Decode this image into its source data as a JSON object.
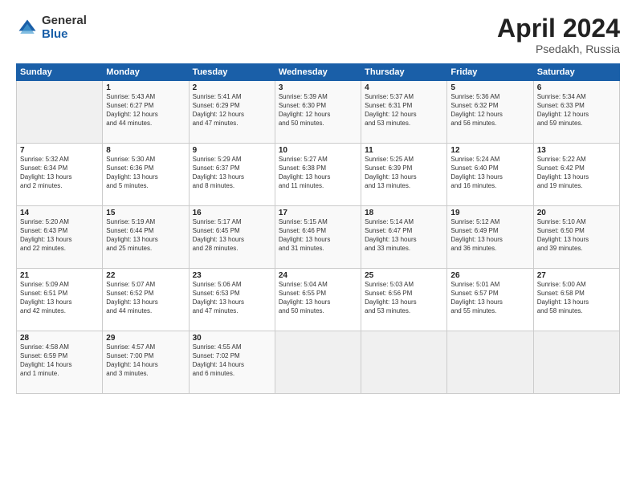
{
  "header": {
    "logo_general": "General",
    "logo_blue": "Blue",
    "title": "April 2024",
    "subtitle": "Psedakh, Russia"
  },
  "days_of_week": [
    "Sunday",
    "Monday",
    "Tuesday",
    "Wednesday",
    "Thursday",
    "Friday",
    "Saturday"
  ],
  "weeks": [
    [
      {
        "day": "",
        "info": ""
      },
      {
        "day": "1",
        "info": "Sunrise: 5:43 AM\nSunset: 6:27 PM\nDaylight: 12 hours\nand 44 minutes."
      },
      {
        "day": "2",
        "info": "Sunrise: 5:41 AM\nSunset: 6:29 PM\nDaylight: 12 hours\nand 47 minutes."
      },
      {
        "day": "3",
        "info": "Sunrise: 5:39 AM\nSunset: 6:30 PM\nDaylight: 12 hours\nand 50 minutes."
      },
      {
        "day": "4",
        "info": "Sunrise: 5:37 AM\nSunset: 6:31 PM\nDaylight: 12 hours\nand 53 minutes."
      },
      {
        "day": "5",
        "info": "Sunrise: 5:36 AM\nSunset: 6:32 PM\nDaylight: 12 hours\nand 56 minutes."
      },
      {
        "day": "6",
        "info": "Sunrise: 5:34 AM\nSunset: 6:33 PM\nDaylight: 12 hours\nand 59 minutes."
      }
    ],
    [
      {
        "day": "7",
        "info": "Sunrise: 5:32 AM\nSunset: 6:34 PM\nDaylight: 13 hours\nand 2 minutes."
      },
      {
        "day": "8",
        "info": "Sunrise: 5:30 AM\nSunset: 6:36 PM\nDaylight: 13 hours\nand 5 minutes."
      },
      {
        "day": "9",
        "info": "Sunrise: 5:29 AM\nSunset: 6:37 PM\nDaylight: 13 hours\nand 8 minutes."
      },
      {
        "day": "10",
        "info": "Sunrise: 5:27 AM\nSunset: 6:38 PM\nDaylight: 13 hours\nand 11 minutes."
      },
      {
        "day": "11",
        "info": "Sunrise: 5:25 AM\nSunset: 6:39 PM\nDaylight: 13 hours\nand 13 minutes."
      },
      {
        "day": "12",
        "info": "Sunrise: 5:24 AM\nSunset: 6:40 PM\nDaylight: 13 hours\nand 16 minutes."
      },
      {
        "day": "13",
        "info": "Sunrise: 5:22 AM\nSunset: 6:42 PM\nDaylight: 13 hours\nand 19 minutes."
      }
    ],
    [
      {
        "day": "14",
        "info": "Sunrise: 5:20 AM\nSunset: 6:43 PM\nDaylight: 13 hours\nand 22 minutes."
      },
      {
        "day": "15",
        "info": "Sunrise: 5:19 AM\nSunset: 6:44 PM\nDaylight: 13 hours\nand 25 minutes."
      },
      {
        "day": "16",
        "info": "Sunrise: 5:17 AM\nSunset: 6:45 PM\nDaylight: 13 hours\nand 28 minutes."
      },
      {
        "day": "17",
        "info": "Sunrise: 5:15 AM\nSunset: 6:46 PM\nDaylight: 13 hours\nand 31 minutes."
      },
      {
        "day": "18",
        "info": "Sunrise: 5:14 AM\nSunset: 6:47 PM\nDaylight: 13 hours\nand 33 minutes."
      },
      {
        "day": "19",
        "info": "Sunrise: 5:12 AM\nSunset: 6:49 PM\nDaylight: 13 hours\nand 36 minutes."
      },
      {
        "day": "20",
        "info": "Sunrise: 5:10 AM\nSunset: 6:50 PM\nDaylight: 13 hours\nand 39 minutes."
      }
    ],
    [
      {
        "day": "21",
        "info": "Sunrise: 5:09 AM\nSunset: 6:51 PM\nDaylight: 13 hours\nand 42 minutes."
      },
      {
        "day": "22",
        "info": "Sunrise: 5:07 AM\nSunset: 6:52 PM\nDaylight: 13 hours\nand 44 minutes."
      },
      {
        "day": "23",
        "info": "Sunrise: 5:06 AM\nSunset: 6:53 PM\nDaylight: 13 hours\nand 47 minutes."
      },
      {
        "day": "24",
        "info": "Sunrise: 5:04 AM\nSunset: 6:55 PM\nDaylight: 13 hours\nand 50 minutes."
      },
      {
        "day": "25",
        "info": "Sunrise: 5:03 AM\nSunset: 6:56 PM\nDaylight: 13 hours\nand 53 minutes."
      },
      {
        "day": "26",
        "info": "Sunrise: 5:01 AM\nSunset: 6:57 PM\nDaylight: 13 hours\nand 55 minutes."
      },
      {
        "day": "27",
        "info": "Sunrise: 5:00 AM\nSunset: 6:58 PM\nDaylight: 13 hours\nand 58 minutes."
      }
    ],
    [
      {
        "day": "28",
        "info": "Sunrise: 4:58 AM\nSunset: 6:59 PM\nDaylight: 14 hours\nand 1 minute."
      },
      {
        "day": "29",
        "info": "Sunrise: 4:57 AM\nSunset: 7:00 PM\nDaylight: 14 hours\nand 3 minutes."
      },
      {
        "day": "30",
        "info": "Sunrise: 4:55 AM\nSunset: 7:02 PM\nDaylight: 14 hours\nand 6 minutes."
      },
      {
        "day": "",
        "info": ""
      },
      {
        "day": "",
        "info": ""
      },
      {
        "day": "",
        "info": ""
      },
      {
        "day": "",
        "info": ""
      }
    ]
  ]
}
